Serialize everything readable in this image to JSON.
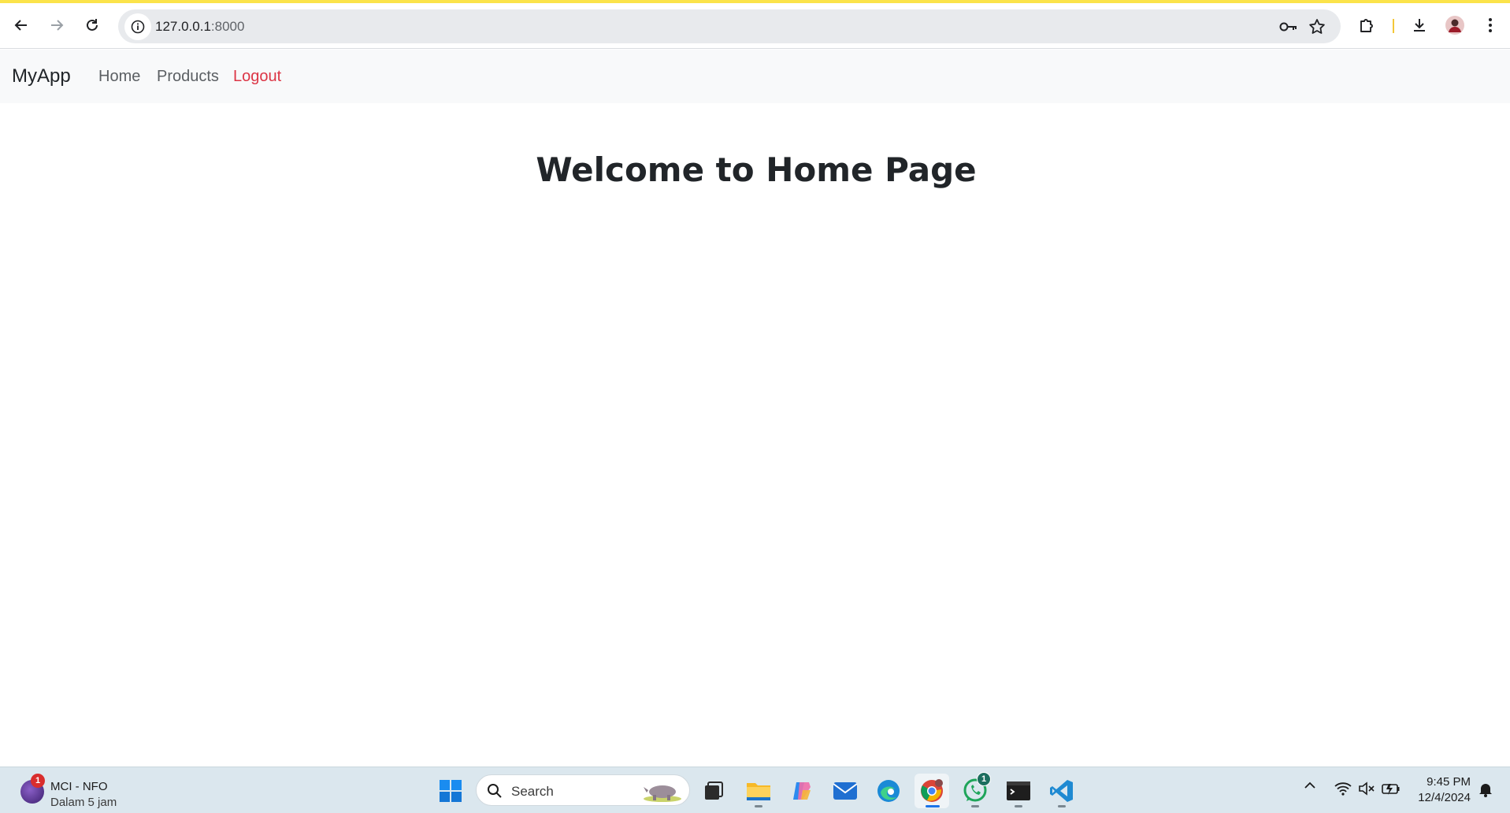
{
  "browser": {
    "url_host": "127.0.0.1",
    "url_port": ":8000",
    "icons": [
      "back-icon",
      "forward-icon",
      "reload-icon",
      "site-info-icon",
      "key-icon",
      "star-icon",
      "extensions-icon",
      "download-icon",
      "avatar",
      "menu-icon"
    ]
  },
  "navbar": {
    "brand": "MyApp",
    "links": [
      {
        "label": "Home"
      },
      {
        "label": "Products"
      },
      {
        "label": "Logout"
      }
    ],
    "logout_color": "#dc3545"
  },
  "main": {
    "heading": "Welcome to Home Page"
  },
  "taskbar": {
    "weather": {
      "badge": "1",
      "title": "MCI - NFO",
      "subtitle": "Dalam 5 jam"
    },
    "search_label": "Search",
    "apps": [
      "start-icon",
      "search",
      "task-view-icon",
      "file-explorer-icon",
      "copilot-icon",
      "mail-icon",
      "edge-icon",
      "chrome-icon",
      "whatsapp-icon",
      "terminal-icon",
      "vscode-icon"
    ],
    "whatsapp_badge": "1",
    "clock": {
      "time": "9:45 PM",
      "date": "12/4/2024"
    }
  }
}
